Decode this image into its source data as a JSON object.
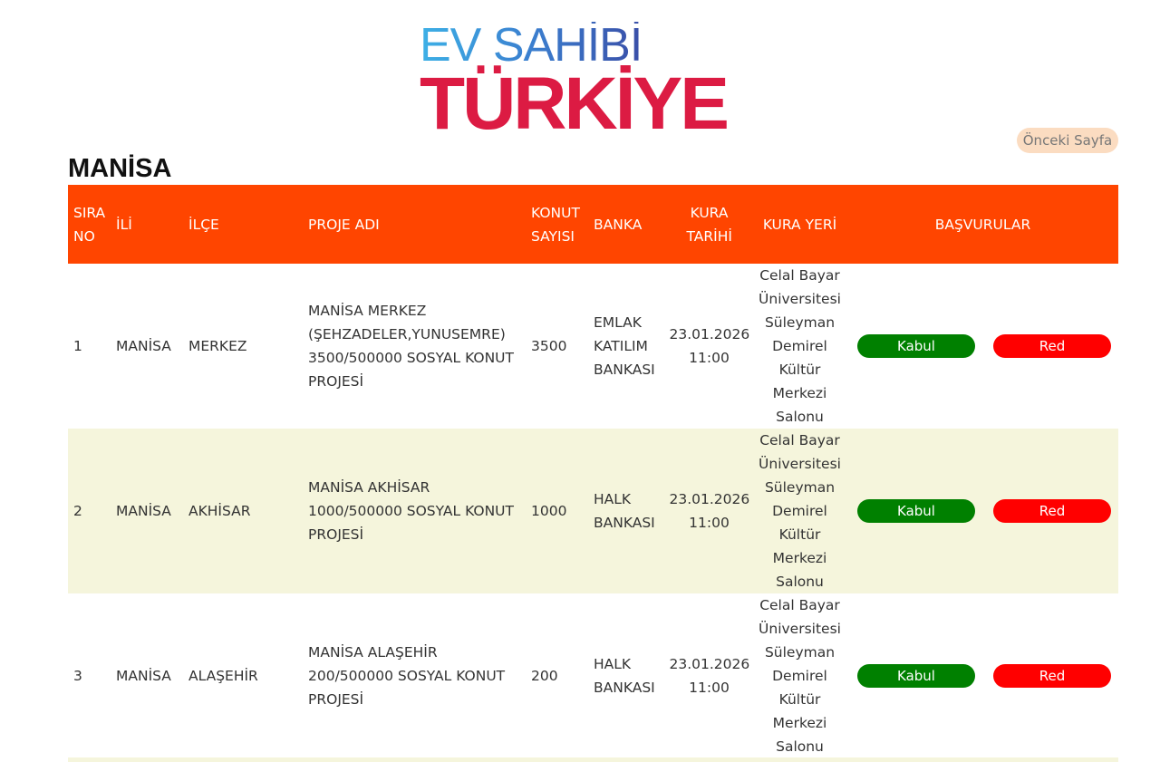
{
  "logo": {
    "line1": "EV SAHİBİ",
    "line2": "TÜRKİYE"
  },
  "nav": {
    "previous_page": "Önceki Sayfa"
  },
  "city_title": "MANİSA",
  "table": {
    "headers": {
      "sira": "SIRA NO",
      "ili": "İLİ",
      "ilce": "İLÇE",
      "proje": "PROJE ADI",
      "konut": "KONUT SAYISI",
      "banka": "BANKA",
      "tarih": "KURA TARİHİ",
      "yer": "KURA YERİ",
      "basvurular": "BAŞVURULAR"
    },
    "rows": [
      {
        "sira": "1",
        "ili": "MANİSA",
        "ilce": "MERKEZ",
        "proje": "MANİSA MERKEZ (ŞEHZADELER,YUNUSEMRE) 3500/500000 SOSYAL KONUT PROJESİ",
        "konut": "3500",
        "banka": "EMLAK KATILIM BANKASI",
        "tarih": "23.01.2026 11:00",
        "yer": "Celal Bayar Üniversitesi Süleyman Demirel Kültür Merkezi Salonu",
        "accept": "Kabul",
        "reject": "Red"
      },
      {
        "sira": "2",
        "ili": "MANİSA",
        "ilce": "AKHİSAR",
        "proje": "MANİSA AKHİSAR 1000/500000 SOSYAL KONUT PROJESİ",
        "konut": "1000",
        "banka": "HALK BANKASI",
        "tarih": "23.01.2026 11:00",
        "yer": "Celal Bayar Üniversitesi Süleyman Demirel Kültür Merkezi Salonu",
        "accept": "Kabul",
        "reject": "Red"
      },
      {
        "sira": "3",
        "ili": "MANİSA",
        "ilce": "ALAŞEHİR",
        "proje": "MANİSA ALAŞEHİR 200/500000 SOSYAL KONUT PROJESİ",
        "konut": "200",
        "banka": "HALK BANKASI",
        "tarih": "23.01.2026 11:00",
        "yer": "Celal Bayar Üniversitesi Süleyman Demirel Kültür Merkezi Salonu",
        "accept": "Kabul",
        "reject": "Red"
      }
    ]
  },
  "colors": {
    "header_bg": "#ff4500",
    "accept": "#008000",
    "reject": "#ff0000",
    "row_alt": "#f5f5dc",
    "logo_red": "#dc1b43",
    "logo_blue": "#3b7fcf"
  }
}
